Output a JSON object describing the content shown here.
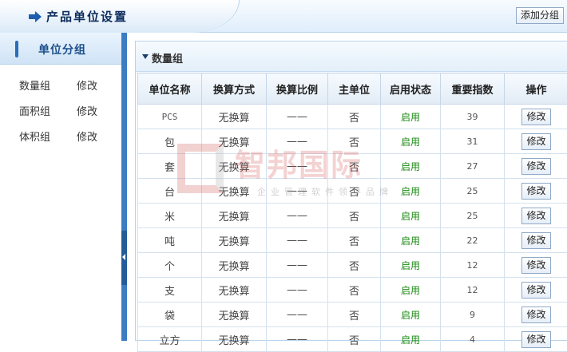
{
  "header": {
    "title": "产品单位设置",
    "add_group_label": "添加分组"
  },
  "sidebar": {
    "title": "单位分组",
    "groups": [
      {
        "name": "数量组",
        "edit": "修改"
      },
      {
        "name": "面积组",
        "edit": "修改"
      },
      {
        "name": "体积组",
        "edit": "修改"
      }
    ]
  },
  "panel": {
    "title": "数量组",
    "columns": [
      "单位名称",
      "换算方式",
      "换算比例",
      "主单位",
      "启用状态",
      "重要指数",
      "操作"
    ],
    "rows": [
      {
        "name": "PCS",
        "method": "无换算",
        "ratio": "——",
        "main": "否",
        "status": "启用",
        "index": "39",
        "action": "修改"
      },
      {
        "name": "包",
        "method": "无换算",
        "ratio": "——",
        "main": "否",
        "status": "启用",
        "index": "31",
        "action": "修改"
      },
      {
        "name": "套",
        "method": "无换算",
        "ratio": "——",
        "main": "否",
        "status": "启用",
        "index": "27",
        "action": "修改"
      },
      {
        "name": "台",
        "method": "无换算",
        "ratio": "——",
        "main": "否",
        "status": "启用",
        "index": "25",
        "action": "修改"
      },
      {
        "name": "米",
        "method": "无换算",
        "ratio": "——",
        "main": "否",
        "status": "启用",
        "index": "25",
        "action": "修改"
      },
      {
        "name": "吨",
        "method": "无换算",
        "ratio": "——",
        "main": "否",
        "status": "启用",
        "index": "22",
        "action": "修改"
      },
      {
        "name": "个",
        "method": "无换算",
        "ratio": "——",
        "main": "否",
        "status": "启用",
        "index": "12",
        "action": "修改"
      },
      {
        "name": "支",
        "method": "无换算",
        "ratio": "——",
        "main": "否",
        "status": "启用",
        "index": "12",
        "action": "修改"
      },
      {
        "name": "袋",
        "method": "无换算",
        "ratio": "——",
        "main": "否",
        "status": "启用",
        "index": "9",
        "action": "修改"
      },
      {
        "name": "立方",
        "method": "无换算",
        "ratio": "——",
        "main": "否",
        "status": "启用",
        "index": "4",
        "action": "修改"
      }
    ]
  },
  "watermark": {
    "text": "智邦国际",
    "subtext": "企业管理软件领导品牌"
  },
  "colors": {
    "accent": "#3b7cc3",
    "status_enabled": "#1a8a12"
  }
}
